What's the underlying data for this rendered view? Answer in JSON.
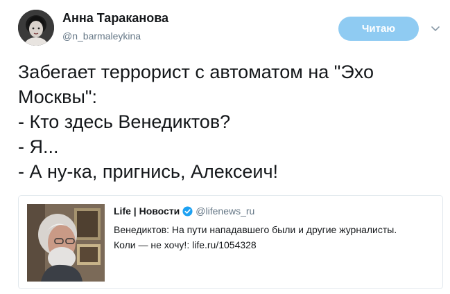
{
  "author": {
    "name": "Анна Тараканова",
    "handle": "@n_barmaleykina"
  },
  "follow_button": {
    "label": "Читаю",
    "color": "#8fcbf2"
  },
  "menu_icon": "chevron-down-icon",
  "tweet": {
    "lines": [
      "Забегает террорист с автоматом на \"Эхо",
      "Москвы\":",
      "- Кто здесь Венедиктов?",
      "- Я...",
      "- А ну-ка, пригнись, Алексеич!"
    ]
  },
  "quoted_tweet": {
    "name": "Life | Новости",
    "verified": true,
    "handle": "@lifenews_ru",
    "lines": [
      "Венедиктов: На пути нападавшего были и другие журналисты.",
      "Коли — не хочу!: life.ru/1054328"
    ]
  },
  "colors": {
    "text": "#14171a",
    "secondary": "#657786",
    "accent": "#1da1f2",
    "border": "#e1e8ed"
  }
}
